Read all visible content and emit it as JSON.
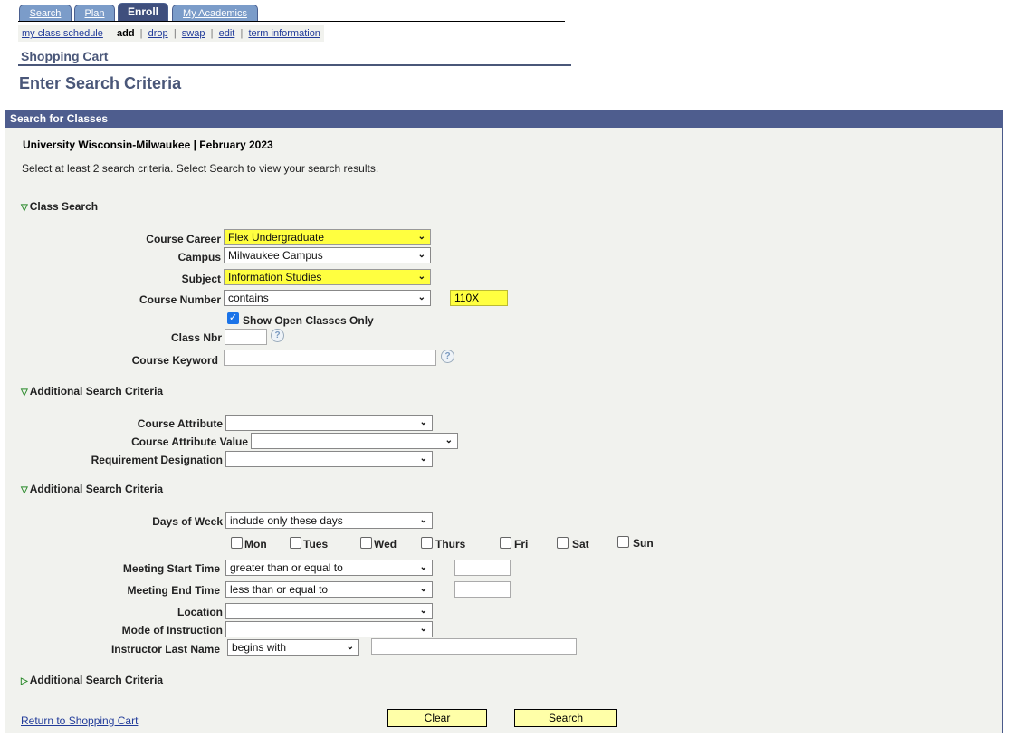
{
  "tabs": [
    {
      "label": "Search"
    },
    {
      "label": "Plan"
    },
    {
      "label": "Enroll",
      "active": true
    },
    {
      "label": "My Academics"
    }
  ],
  "subnav": {
    "my_class_schedule": "my class schedule",
    "add": "add",
    "drop": "drop",
    "swap": "swap",
    "edit": "edit",
    "term_information": "term information",
    "separator": "|"
  },
  "section_title": "Shopping Cart",
  "page_title": "Enter Search Criteria",
  "panel": {
    "title": "Search for Classes",
    "term": "University Wisconsin-Milwaukee | February 2023",
    "instructions": "Select at least 2 search criteria. Select Search to view your search results."
  },
  "class_search": {
    "heading": "Class Search",
    "course_career": {
      "label": "Course Career",
      "value": "Flex Undergraduate"
    },
    "campus": {
      "label": "Campus",
      "value": "Milwaukee Campus"
    },
    "subject": {
      "label": "Subject",
      "value": "Information Studies"
    },
    "course_number": {
      "label": "Course Number",
      "operator": "contains",
      "value": "110X"
    },
    "open_only": {
      "label": "Show Open Classes Only",
      "checked": true
    },
    "class_nbr": {
      "label": "Class Nbr",
      "value": ""
    },
    "course_keyword": {
      "label": "Course Keyword",
      "value": ""
    }
  },
  "additional1": {
    "heading": "Additional Search Criteria",
    "course_attribute": {
      "label": "Course Attribute",
      "value": ""
    },
    "course_attribute_value": {
      "label": "Course Attribute Value",
      "value": ""
    },
    "requirement_designation": {
      "label": "Requirement Designation",
      "value": ""
    }
  },
  "additional2": {
    "heading": "Additional Search Criteria",
    "days_of_week": {
      "label": "Days of Week",
      "value": "include only these days"
    },
    "days": [
      {
        "label": "Mon"
      },
      {
        "label": "Tues"
      },
      {
        "label": "Wed"
      },
      {
        "label": "Thurs"
      },
      {
        "label": "Fri"
      },
      {
        "label": "Sat"
      },
      {
        "label": "Sun"
      }
    ],
    "meeting_start": {
      "label": "Meeting Start Time",
      "operator": "greater than or equal to",
      "value": ""
    },
    "meeting_end": {
      "label": "Meeting End Time",
      "operator": "less than or equal to",
      "value": ""
    },
    "location": {
      "label": "Location",
      "value": ""
    },
    "mode": {
      "label": "Mode of Instruction",
      "value": ""
    },
    "instructor": {
      "label": "Instructor Last Name",
      "operator": "begins with",
      "value": ""
    }
  },
  "additional3": {
    "heading": "Additional Search Criteria"
  },
  "footer": {
    "return_link": "Return to Shopping Cart",
    "clear": "Clear",
    "search": "Search"
  },
  "colors": {
    "highlight": "#ffff40",
    "header_bar": "#4e5d8e",
    "button": "#ffffa8"
  }
}
